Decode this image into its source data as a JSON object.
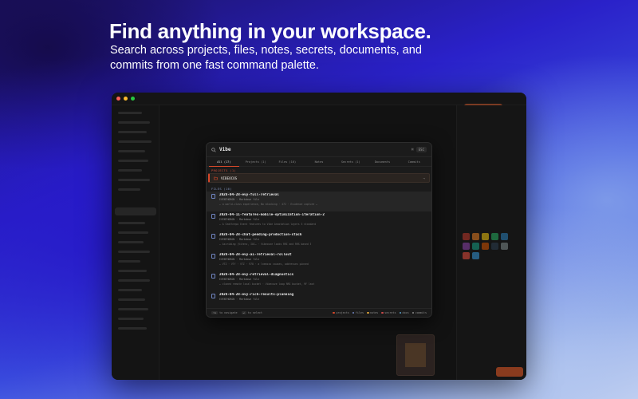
{
  "hero": {
    "title": "Find anything in your workspace.",
    "subtitle": "Search across projects, files, notes, secrets, documents, and commits from one fast command palette."
  },
  "palette": {
    "search": {
      "value": "Vibe",
      "clear_label": "⌘",
      "esc_label": "ESC"
    },
    "tabs": [
      {
        "label": "All (17)"
      },
      {
        "label": "Projects (1)"
      },
      {
        "label": "Files (16)"
      },
      {
        "label": "Notes"
      },
      {
        "label": "Secrets (1)"
      },
      {
        "label": "Documents"
      },
      {
        "label": "Commits"
      }
    ],
    "projects_header": "PROJECTS (1)",
    "project": {
      "name": "VIBEOCOS",
      "arrow": "→"
    },
    "files_header": "FILES (16)",
    "files": [
      {
        "name": "2026-04-28-evy-full-retrieval",
        "meta": "EVENTHORON · Markdown file",
        "snippet": "… a world-class experience, No blocking · 472 · Evidence capture …"
      },
      {
        "name": "2026-04-11-features-mobile-optimization-iteration-2",
        "meta": "EVENTHORON · Markdown file",
        "snippet": "… A Ceathrepo Event features to Vibe Annotation layers 3 standard"
      },
      {
        "name": "2026-04-28-chat-pending-production-stack",
        "meta": "EVENTHORON · Markdown file",
        "snippet": "… Ascribing (Vitenz, IOC… · Vibecoze looks RRI and RRS based 5"
      },
      {
        "name": "2026-04-28-evy-ai-retrieval-rollout",
        "meta": "EVENTHORON · Markdown file",
        "snippet": "… VTZ · VTY · VTZ · 978 · a lnemzzo causes, addresses pinned"
      },
      {
        "name": "2026-04-28-evy-retrieval-diagnostics",
        "meta": "EVENTHORON · Markdown file",
        "snippet": "… cloned remote local bucket · Vibecoze loop RRS bucket, 9F last"
      },
      {
        "name": "2026-04-28-evy-rich-results-planning",
        "meta": "EVENTHORON · Markdown file",
        "snippet": ""
      }
    ],
    "footer": {
      "navigate_key": "↑↓",
      "navigate_label": "to navigate",
      "select_key": "↵",
      "select_label": "to select",
      "legend": [
        {
          "label": "projects",
          "color": "#d8482a"
        },
        {
          "label": "files",
          "color": "#6f84c0"
        },
        {
          "label": "notes",
          "color": "#d8a23a"
        },
        {
          "label": "secrets",
          "color": "#c94a4a"
        },
        {
          "label": "docs",
          "color": "#5aa0c8"
        },
        {
          "label": "commits",
          "color": "#8a8a8a"
        }
      ]
    }
  },
  "colors": {
    "accent": "#d8482a",
    "palette_bg": "#1b1b1b",
    "window_bg": "#121212"
  },
  "swatches": [
    "#c0392b",
    "#e67e22",
    "#f1c40f",
    "#27ae60",
    "#2980b9",
    "#8e44ad",
    "#16a085",
    "#d35400",
    "#2c3e50",
    "#7f8c8d",
    "#e74c3c",
    "#3498db"
  ]
}
